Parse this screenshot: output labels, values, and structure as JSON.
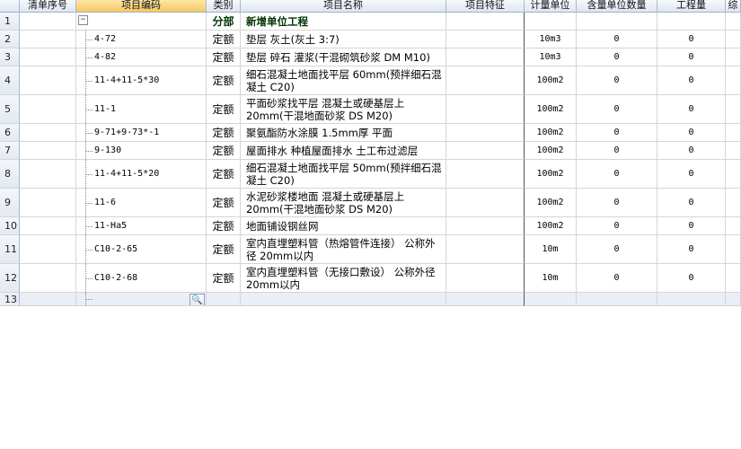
{
  "headers": [
    "清单序号",
    "项目编码",
    "类别",
    "项目名称",
    "项目特征",
    "计量单位",
    "含量单位数量",
    "工程量",
    "综"
  ],
  "rows": [
    {
      "no": "1",
      "code": "",
      "type": "分部",
      "name": "新增单位工程",
      "feature": "",
      "unit": "",
      "qty": "",
      "amount": ""
    },
    {
      "no": "2",
      "code": "4-72",
      "type": "定额",
      "name": "垫层 灰土(灰土 3:7)",
      "feature": "",
      "unit": "10m3",
      "qty": "0",
      "amount": "0"
    },
    {
      "no": "3",
      "code": "4-82",
      "type": "定额",
      "name": "垫层 碎石 灌浆(干混砌筑砂浆 DM M10)",
      "feature": "",
      "unit": "10m3",
      "qty": "0",
      "amount": "0"
    },
    {
      "no": "4",
      "code": "11-4+11-5*30",
      "type": "定额",
      "name": "细石混凝土地面找平层 60mm(预拌细石混凝土 C20)",
      "feature": "",
      "unit": "100m2",
      "qty": "0",
      "amount": "0"
    },
    {
      "no": "5",
      "code": "11-1",
      "type": "定额",
      "name": "平面砂浆找平层 混凝土或硬基层上 20mm(干混地面砂浆 DS M20)",
      "feature": "",
      "unit": "100m2",
      "qty": "0",
      "amount": "0"
    },
    {
      "no": "6",
      "code": "9-71+9-73*-1",
      "type": "定额",
      "name": "聚氨酯防水涂膜 1.5mm厚 平面",
      "feature": "",
      "unit": "100m2",
      "qty": "0",
      "amount": "0"
    },
    {
      "no": "7",
      "code": "9-130",
      "type": "定额",
      "name": "屋面排水 种植屋面排水 土工布过滤层",
      "feature": "",
      "unit": "100m2",
      "qty": "0",
      "amount": "0"
    },
    {
      "no": "8",
      "code": "11-4+11-5*20",
      "type": "定额",
      "name": "细石混凝土地面找平层 50mm(预拌细石混凝土 C20)",
      "feature": "",
      "unit": "100m2",
      "qty": "0",
      "amount": "0"
    },
    {
      "no": "9",
      "code": "11-6",
      "type": "定额",
      "name": "水泥砂浆楼地面 混凝土或硬基层上 20mm(干混地面砂浆 DS M20)",
      "feature": "",
      "unit": "100m2",
      "qty": "0",
      "amount": "0"
    },
    {
      "no": "10",
      "code": "11-Ha5",
      "type": "定额",
      "name": "地面铺设钢丝网",
      "feature": "",
      "unit": "100m2",
      "qty": "0",
      "amount": "0"
    },
    {
      "no": "11",
      "code": "C10-2-65",
      "type": "定额",
      "name": "室内直埋塑料管（热熔管件连接） 公称外径 20mm以内",
      "feature": "",
      "unit": "10m",
      "qty": "0",
      "amount": "0"
    },
    {
      "no": "12",
      "code": "C10-2-68",
      "type": "定额",
      "name": "室内直埋塑料管（无接口敷设） 公称外径 20mm以内",
      "feature": "",
      "unit": "10m",
      "qty": "0",
      "amount": "0"
    },
    {
      "no": "13",
      "code": "",
      "type": "",
      "name": "",
      "feature": "",
      "unit": "",
      "qty": "",
      "amount": ""
    }
  ],
  "icons": {
    "collapse": "minus-box-icon",
    "search": "magnifier-icon"
  },
  "collapse_glyph": "−",
  "search_glyph": "🔍"
}
